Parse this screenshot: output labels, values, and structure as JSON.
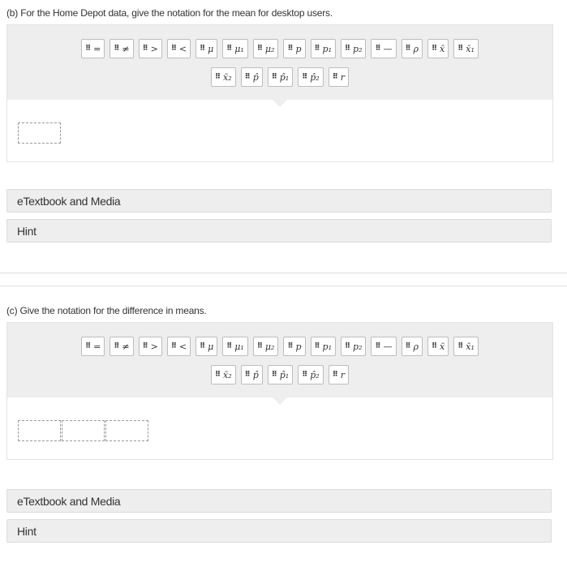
{
  "part_b": {
    "question": "(b) For the Home Depot data, give the notation for the mean for desktop users.",
    "palette_row1": [
      {
        "sym": "=",
        "icon": "equals"
      },
      {
        "sym": "≠",
        "icon": "not-equal"
      },
      {
        "sym": ">",
        "icon": "greater-than"
      },
      {
        "sym": "<",
        "icon": "less-than"
      },
      {
        "sym": "μ",
        "icon": "mu"
      },
      {
        "sym": "μ₁",
        "icon": "mu-1"
      },
      {
        "sym": "μ₂",
        "icon": "mu-2"
      },
      {
        "sym": "p",
        "icon": "p"
      },
      {
        "sym": "p₁",
        "icon": "p-1"
      },
      {
        "sym": "p₂",
        "icon": "p-2"
      },
      {
        "sym": "—",
        "icon": "minus"
      },
      {
        "sym": "ρ",
        "icon": "rho"
      },
      {
        "sym": "x̄",
        "icon": "x-bar"
      },
      {
        "sym": "x̄₁",
        "icon": "x-bar-1"
      }
    ],
    "palette_row2": [
      {
        "sym": "x̄₂",
        "icon": "x-bar-2"
      },
      {
        "sym": "p̂",
        "icon": "p-hat"
      },
      {
        "sym": "p̂₁",
        "icon": "p-hat-1"
      },
      {
        "sym": "p̂₂",
        "icon": "p-hat-2"
      },
      {
        "sym": "r",
        "icon": "r"
      }
    ],
    "etextbook_label": "eTextbook and Media",
    "hint_label": "Hint"
  },
  "part_c": {
    "question": "(c) Give the notation for the difference in means.",
    "palette_row1": [
      {
        "sym": "=",
        "icon": "equals"
      },
      {
        "sym": "≠",
        "icon": "not-equal"
      },
      {
        "sym": ">",
        "icon": "greater-than"
      },
      {
        "sym": "<",
        "icon": "less-than"
      },
      {
        "sym": "μ",
        "icon": "mu"
      },
      {
        "sym": "μ₁",
        "icon": "mu-1"
      },
      {
        "sym": "μ₂",
        "icon": "mu-2"
      },
      {
        "sym": "p",
        "icon": "p"
      },
      {
        "sym": "p₁",
        "icon": "p-1"
      },
      {
        "sym": "p₂",
        "icon": "p-2"
      },
      {
        "sym": "—",
        "icon": "minus"
      },
      {
        "sym": "ρ",
        "icon": "rho"
      },
      {
        "sym": "x̄",
        "icon": "x-bar"
      },
      {
        "sym": "x̄₁",
        "icon": "x-bar-1"
      }
    ],
    "palette_row2": [
      {
        "sym": "x̄₂",
        "icon": "x-bar-2"
      },
      {
        "sym": "p̂",
        "icon": "p-hat"
      },
      {
        "sym": "p̂₁",
        "icon": "p-hat-1"
      },
      {
        "sym": "p̂₂",
        "icon": "p-hat-2"
      },
      {
        "sym": "r",
        "icon": "r"
      }
    ],
    "etextbook_label": "eTextbook and Media",
    "hint_label": "Hint"
  },
  "grip_glyph": "⠿",
  "colors": {
    "palette_bg": "#eeeeee",
    "tile_border": "#bdbdbd",
    "bar_bg": "#eeeeee",
    "slot_border": "#999999"
  }
}
